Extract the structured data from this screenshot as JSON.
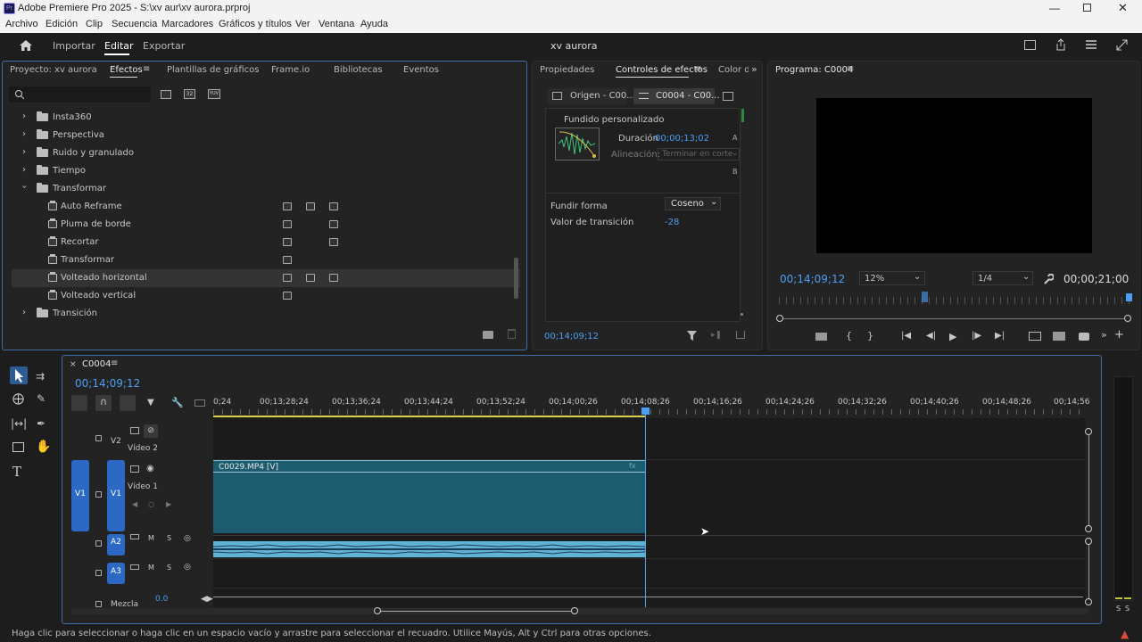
{
  "window": {
    "title": "Adobe Premiere Pro 2025 - S:\\xv aur\\xv aurora.prproj",
    "app_icon": "Pr"
  },
  "menu": [
    "Archivo",
    "Edición",
    "Clip",
    "Secuencia",
    "Marcadores",
    "Gráficos y títulos",
    "Ver",
    "Ventana",
    "Ayuda"
  ],
  "workspace": {
    "tabs": [
      "Importar",
      "Editar",
      "Exportar"
    ],
    "active": "Editar",
    "project_name": "xv aurora"
  },
  "effects_panel": {
    "tabs": [
      "Proyecto: xv aurora",
      "Efectos",
      "Plantillas de gráficos",
      "Frame.io",
      "Bibliotecas",
      "Eventos"
    ],
    "active_tab": "Efectos",
    "search_placeholder": "",
    "badge_labels": [
      "32",
      "YUV"
    ],
    "folders_before": [
      "Insta360",
      "Perspectiva",
      "Ruido y granulado",
      "Tiempo"
    ],
    "open_folder": "Transformar",
    "items": [
      "Auto Reframe",
      "Pluma de borde",
      "Recortar",
      "Transformar",
      "Volteado horizontal",
      "Volteado vertical"
    ],
    "selected_item": "Volteado horizontal",
    "folders_after": [
      "Transición"
    ]
  },
  "effect_controls": {
    "tabs": [
      "Propiedades",
      "Controles de efectos",
      "Color de"
    ],
    "active_tab": "Controles de efectos",
    "source_tabs": [
      "Origen - C00...",
      "C0004 - C00..."
    ],
    "transition_name": "Fundido personalizado",
    "duration_label": "Duración",
    "duration_value": "00;00;13;02",
    "alignment_label": "Alineación:",
    "alignment_value": "Terminar en corte",
    "marker_a": "A",
    "marker_b": "B",
    "shape_label": "Fundir forma",
    "shape_value": "Coseno",
    "transition_value_label": "Valor de transición",
    "transition_value": "-28",
    "timecode": "00;14;09;12"
  },
  "program_monitor": {
    "title": "Programa: C0004",
    "timecode": "00;14;09;12",
    "zoom": "12%",
    "resolution": "1/4",
    "duration": "00;00;21;00"
  },
  "timeline": {
    "sequence_name": "C0004",
    "timecode": "00;14;09;12",
    "ruler": [
      "0;24",
      "00;13;28;24",
      "00;13;36;24",
      "00;13;44;24",
      "00;13;52;24",
      "00;14;00;26",
      "00;14;08;26",
      "00;14;16;26",
      "00;14;24;26",
      "00;14;32;26",
      "00;14;40;26",
      "00;14;48;26",
      "00;14;56"
    ],
    "tracks": [
      {
        "id": "V2",
        "name": "Vídeo 2"
      },
      {
        "id": "V1",
        "name": "Vídeo 1",
        "src": "V1"
      },
      {
        "id": "A2",
        "toggles": [
          "M",
          "S"
        ]
      },
      {
        "id": "A3",
        "toggles": [
          "M",
          "S"
        ]
      }
    ],
    "mix_label": "Mezcla",
    "mix_value": "0.0",
    "clip_label": "C0029.MP4 [V]",
    "meter_labels": [
      "S",
      "S"
    ]
  },
  "status_bar": "Haga clic para seleccionar o haga clic en un espacio vacío y arrastre para seleccionar el recuadro. Utilice Mayús, Alt y Ctrl para otras opciones.",
  "colors": {
    "accent_blue": "#4a9ff5",
    "clip_teal": "#1d5b6e",
    "audio_clip": "#5fb3d6",
    "track_blue": "#2b69c4"
  }
}
